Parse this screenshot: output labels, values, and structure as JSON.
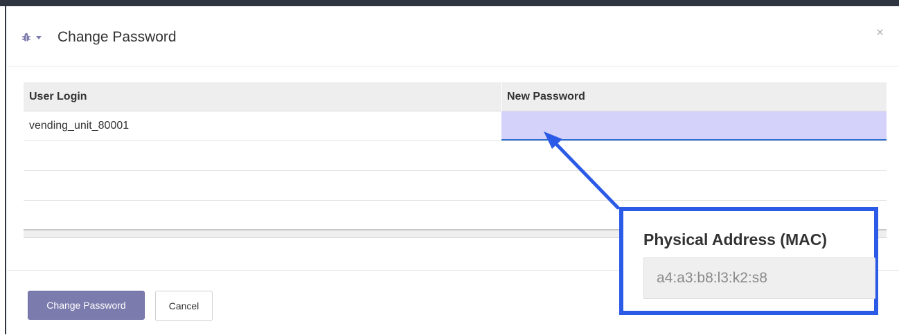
{
  "dialog": {
    "title": "Change Password",
    "close_label": "×",
    "icons": {
      "debug": "bug-icon",
      "dropdown": "caret-down-icon"
    }
  },
  "table": {
    "columns": [
      "User Login",
      "New Password"
    ],
    "rows": [
      {
        "user_login": "vending_unit_80001",
        "new_password": ""
      }
    ]
  },
  "footer": {
    "primary_label": "Change Password",
    "cancel_label": "Cancel"
  },
  "callout": {
    "title": "Physical Address (MAC)",
    "value": "a4:a3:b8:l3:k2:s8"
  },
  "colors": {
    "accent": "#7c7bad",
    "highlight_cell": "#d4d2fb",
    "callout_border": "#2b5be6"
  }
}
